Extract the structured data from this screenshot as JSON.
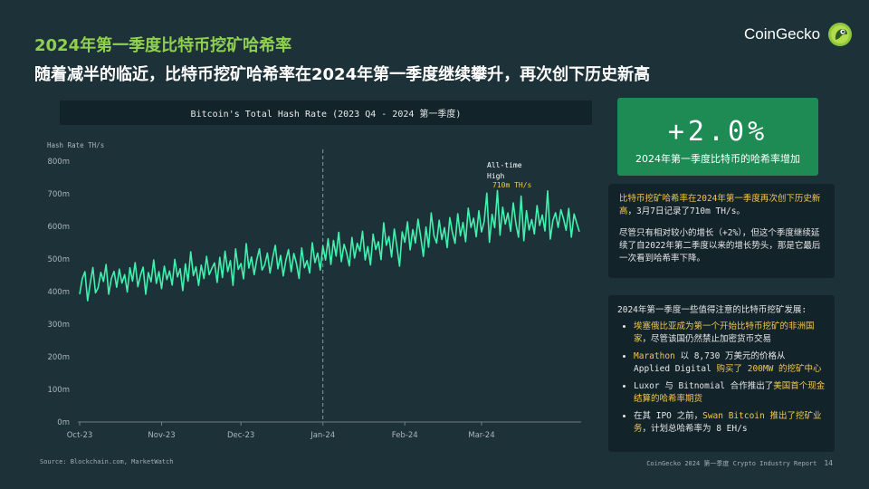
{
  "header": {
    "title": "2024年第一季度比特币挖矿哈希率",
    "subtitle": "随着减半的临近，比特币挖矿哈希率在2024年第一季度继续攀升，再次创下历史新高"
  },
  "logo": {
    "text": "CoinGecko",
    "icon": "gecko-icon"
  },
  "stat": {
    "value": "+2.0%",
    "label": "2024年第一季度比特币的哈希率增加"
  },
  "panel1": {
    "p1_hl": "比特币挖矿哈希率在2024年第一季度再次创下历史新高",
    "p1_rest": "，3月7日记录了710m TH/s。",
    "p2": "尽管只有相对较小的增长（+2%），但这个季度继续延续了自2022年第二季度以来的增长势头，那是它最后一次看到哈希率下降。"
  },
  "panel2": {
    "heading": "2024年第一季度一些值得注意的比特币挖矿发展:",
    "items": [
      {
        "hl": "埃塞俄比亚成为第一个开始比特币挖矿的非洲国家",
        "rest": "，尽管该国仍然禁止加密货币交易"
      },
      {
        "pre_hl": "Marathon",
        "mid": " 以 8,730 万美元的价格从 Applied Digital ",
        "hl": "购买了 200MW 的挖矿中心"
      },
      {
        "pre": "Luxor 与 Bitnomial 合作推出了",
        "hl": "美国首个现金结算的哈希率期货"
      },
      {
        "pre": "在其 IPO 之前，",
        "hl": "Swan Bitcoin 推出了挖矿业务",
        "rest": "，计划总哈希率为 8 EH/s"
      }
    ]
  },
  "source": "Source: Blockchain.com, MarketWatch",
  "footer": {
    "text": "CoinGecko 2024 第一季度 Crypto Industry Report",
    "page": "14"
  },
  "colors": {
    "line": "#40f2ae",
    "accent": "#8fd14f",
    "highlight": "#f5c84c",
    "stat_bg": "#1e8a54"
  },
  "chart_data": {
    "type": "line",
    "title": "Bitcoin's Total Hash Rate (2023 Q4 - 2024 第一季度)",
    "ylabel": "Hash Rate TH/s",
    "ylim": [
      0,
      800
    ],
    "y_ticks": [
      "0m",
      "100m",
      "200m",
      "300m",
      "400m",
      "500m",
      "600m",
      "700m",
      "800m"
    ],
    "x_ticks": [
      "Oct-23",
      "Nov-23",
      "Dec-23",
      "Jan-24",
      "Feb-24",
      "Mar-24"
    ],
    "x_tick_index": [
      0,
      31,
      61,
      92,
      123,
      152
    ],
    "divider_index": 92,
    "annotation": {
      "line1": "All-time",
      "line2": "High",
      "value": "710m TH/s",
      "index": 158,
      "y": 710
    },
    "values": [
      392,
      440,
      461,
      372,
      426,
      474,
      396,
      412,
      459,
      431,
      483,
      392,
      440,
      462,
      413,
      469,
      426,
      452,
      399,
      473,
      432,
      489,
      415,
      450,
      475,
      392,
      458,
      430,
      497,
      425,
      461,
      409,
      478,
      437,
      463,
      420,
      499,
      445,
      470,
      403,
      485,
      432,
      522,
      449,
      476,
      419,
      481,
      440,
      508,
      452,
      471,
      488,
      428,
      505,
      443,
      524,
      461,
      495,
      419,
      531,
      468,
      486,
      439,
      547,
      472,
      506,
      452,
      498,
      531,
      466,
      482,
      518,
      457,
      503,
      542,
      470,
      511,
      448,
      496,
      529,
      461,
      517,
      486,
      440,
      534,
      473,
      495,
      457,
      550,
      489,
      518,
      466,
      540,
      497,
      562,
      483,
      557,
      509,
      582,
      492,
      545,
      518,
      479,
      566,
      503,
      548,
      524,
      585,
      497,
      538,
      482,
      576,
      529,
      553,
      498,
      611,
      542,
      569,
      506,
      592,
      537,
      478,
      583,
      551,
      614,
      528,
      590,
      549,
      622,
      567,
      508,
      598,
      536,
      641,
      572,
      549,
      619,
      560,
      596,
      535,
      627,
      581,
      548,
      639,
      571,
      612,
      553,
      656,
      597,
      625,
      568,
      648,
      583,
      615,
      702,
      551,
      637,
      596,
      710,
      573,
      659,
      607,
      641,
      585,
      672,
      609,
      567,
      693,
      556,
      648,
      589,
      621,
      577,
      664,
      603,
      635,
      586,
      709,
      561,
      618,
      642,
      597,
      651,
      624,
      588,
      655,
      567,
      638,
      610,
      584
    ]
  }
}
